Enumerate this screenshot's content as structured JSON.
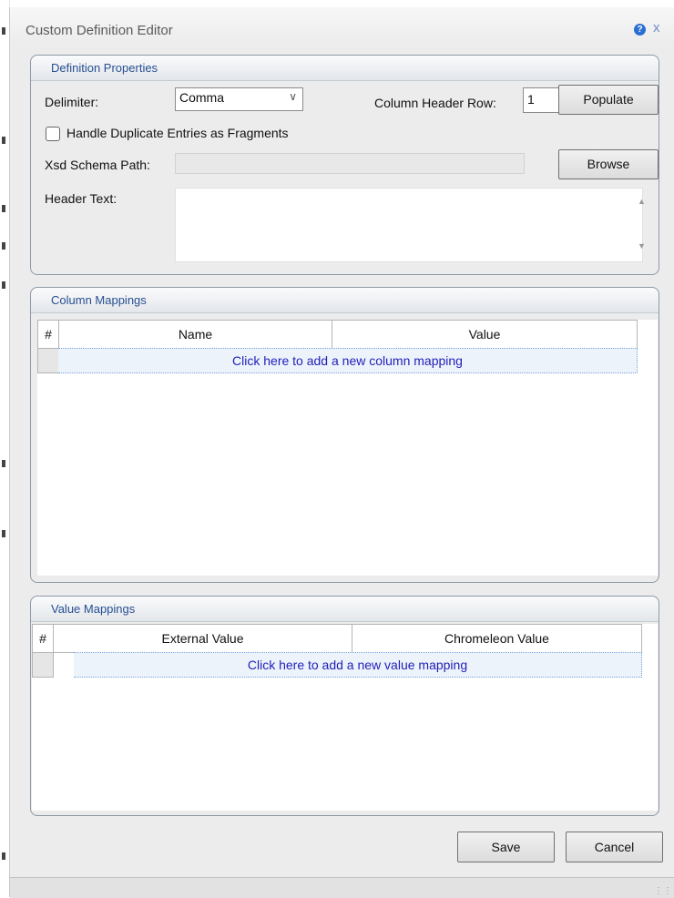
{
  "window": {
    "title": "Custom Definition Editor",
    "help_glyph": "?",
    "close_glyph": "x"
  },
  "definition": {
    "title": "Definition Properties",
    "delimiter_label": "Delimiter:",
    "delimiter_value": "Comma",
    "column_header_row_label": "Column Header Row:",
    "column_header_row_value": "1",
    "populate_label": "Populate",
    "handle_duplicates_label": "Handle Duplicate Entries as Fragments",
    "handle_duplicates_checked": false,
    "xsd_label": "Xsd Schema Path:",
    "xsd_value": "",
    "browse_label": "Browse",
    "header_text_label": "Header Text:",
    "header_text_value": ""
  },
  "column_mappings": {
    "title": "Column Mappings",
    "columns": [
      "#",
      "Name",
      "Value"
    ],
    "add_row_text": "Click here to add a new column mapping"
  },
  "value_mappings": {
    "title": "Value Mappings",
    "columns": [
      "#",
      "External Value",
      "Chromeleon Value"
    ],
    "add_row_text": "Click here to add a new value mapping"
  },
  "footer": {
    "save_label": "Save",
    "cancel_label": "Cancel"
  },
  "colors": {
    "group_title": "#274f92",
    "link": "#1f1fb8",
    "window_bg": "#ececec"
  },
  "icons": {
    "combo_arrow": "chevron-down-icon",
    "help": "help-icon",
    "close": "close-icon",
    "resize": "resize-grip-icon"
  }
}
